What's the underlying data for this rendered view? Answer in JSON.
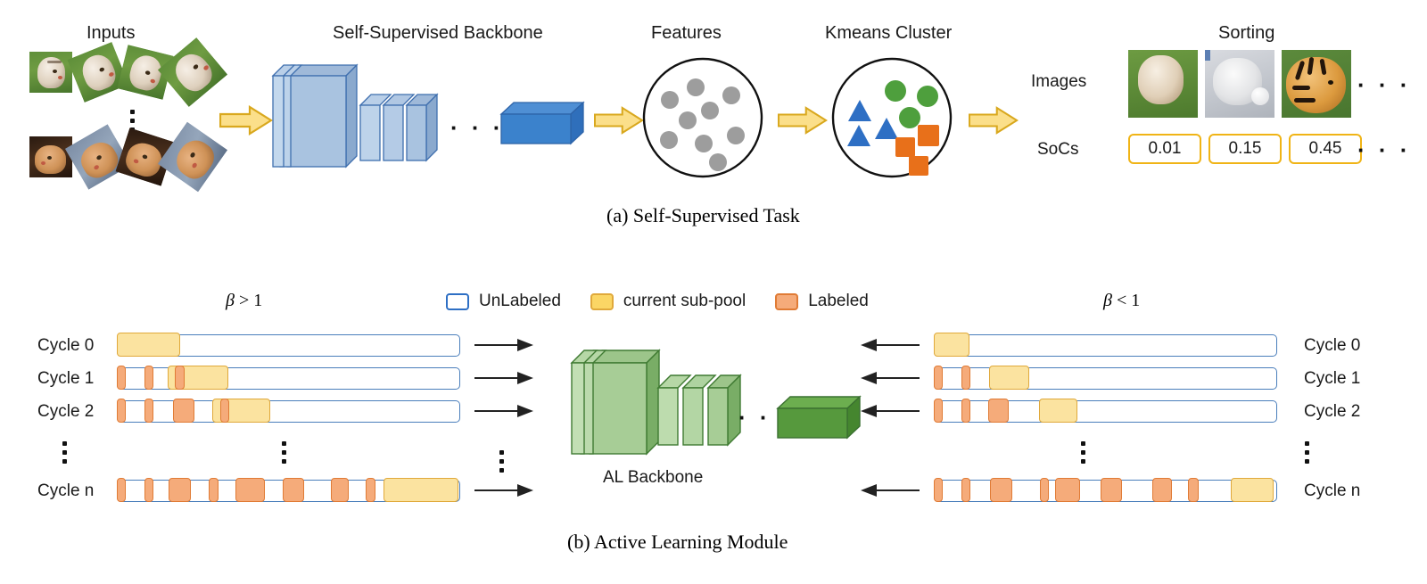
{
  "figure": {
    "caption_a": "(a) Self-Supervised Task",
    "caption_b": "(b) Active Learning Module"
  },
  "panel_a": {
    "titles": {
      "inputs": "Inputs",
      "backbone": "Self-Supervised Backbone",
      "features": "Features",
      "kmeans": "Kmeans Cluster",
      "sorting": "Sorting"
    },
    "row_labels": {
      "images": "Images",
      "socs": "SoCs"
    },
    "socs_values": [
      "0.01",
      "0.15",
      "0.45"
    ],
    "ellipsis": "· · ·",
    "backbone_ellipsis": "· · ·",
    "features_points": 10,
    "cluster_groups": [
      {
        "name": "green-circles",
        "shape": "circle",
        "color": "#4e9f3d",
        "count": 3
      },
      {
        "name": "blue-triangles",
        "shape": "triangle",
        "color": "#2e6fc4",
        "count": 3
      },
      {
        "name": "orange-squares",
        "shape": "square",
        "color": "#e8701a",
        "count": 3
      }
    ]
  },
  "panel_b": {
    "beta_left": {
      "sym": "β",
      "rel": " > ",
      "val": "1"
    },
    "beta_right": {
      "sym": "β",
      "rel": " < ",
      "val": "1"
    },
    "legend": [
      {
        "label": "UnLabeled",
        "color": "#ffffff",
        "border": "#2e6fc4"
      },
      {
        "label": "current sub-pool",
        "color": "#fbd665",
        "border": "#e0a93b"
      },
      {
        "label": "Labeled",
        "color": "#f5ab7a",
        "border": "#e07b35"
      }
    ],
    "backbone_label": "AL Backbone",
    "backbone_ellipsis": "· · ·",
    "left_rows": [
      {
        "label": "Cycle 0",
        "labeled": [],
        "subpool": {
          "x": 0,
          "w": 18.5
        }
      },
      {
        "label": "Cycle 1",
        "labeled": [
          {
            "x": 0,
            "w": 2.6
          },
          {
            "x": 8.2,
            "w": 2.6
          },
          {
            "x": 17.1,
            "w": 2.8
          }
        ],
        "subpool": {
          "x": 15.0,
          "w": 17.6
        }
      },
      {
        "label": "Cycle 2",
        "labeled": [
          {
            "x": 0,
            "w": 2.6
          },
          {
            "x": 8.2,
            "w": 2.6
          },
          {
            "x": 16.5,
            "w": 6.2
          },
          {
            "x": 30.2,
            "w": 2.8
          }
        ],
        "subpool": {
          "x": 28.0,
          "w": 16.8
        }
      },
      {
        "label": "Cycle n",
        "labeled": [
          {
            "x": 0,
            "w": 2.6
          },
          {
            "x": 8.2,
            "w": 2.6
          },
          {
            "x": 15.2,
            "w": 6.4
          },
          {
            "x": 26.8,
            "w": 3.0
          },
          {
            "x": 34.8,
            "w": 8.6
          },
          {
            "x": 48.5,
            "w": 6.4
          },
          {
            "x": 62.6,
            "w": 5.4
          },
          {
            "x": 72.8,
            "w": 3.0
          }
        ],
        "subpool": {
          "x": 78.0,
          "w": 22.0
        }
      }
    ],
    "right_rows": [
      {
        "label": "Cycle 0",
        "labeled": [],
        "subpool": {
          "x": 0,
          "w": 10.5
        }
      },
      {
        "label": "Cycle 1",
        "labeled": [
          {
            "x": 0,
            "w": 2.6
          },
          {
            "x": 8.2,
            "w": 2.6
          },
          {
            "x": 15.8,
            "w": 0
          }
        ],
        "subpool": {
          "x": 16.2,
          "w": 11.8
        }
      },
      {
        "label": "Cycle 2",
        "labeled": [
          {
            "x": 0,
            "w": 2.6
          },
          {
            "x": 8.2,
            "w": 2.6
          },
          {
            "x": 16.0,
            "w": 6.0
          },
          {
            "x": 30.5,
            "w": 0
          }
        ],
        "subpool": {
          "x": 30.8,
          "w": 11.2
        }
      },
      {
        "label": "Cycle n",
        "labeled": [
          {
            "x": 0,
            "w": 2.6
          },
          {
            "x": 8.2,
            "w": 2.6
          },
          {
            "x": 16.5,
            "w": 6.4
          },
          {
            "x": 31.0,
            "w": 2.6
          },
          {
            "x": 35.5,
            "w": 7.4
          },
          {
            "x": 48.8,
            "w": 6.4
          },
          {
            "x": 64.0,
            "w": 5.6
          },
          {
            "x": 74.5,
            "w": 3.0
          }
        ],
        "subpool": {
          "x": 87.0,
          "w": 12.6
        }
      }
    ]
  }
}
